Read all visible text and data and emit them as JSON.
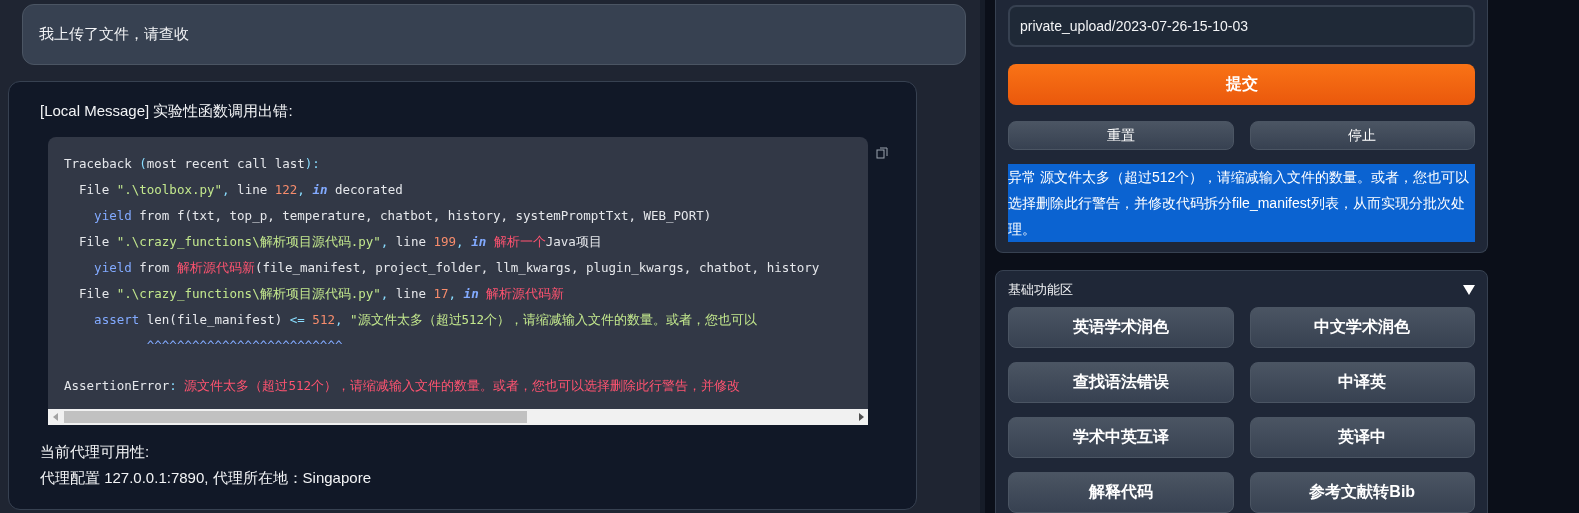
{
  "user_message": {
    "text": "我上传了文件，请查收"
  },
  "bot_message": {
    "title": "[Local Message] 实验性函数调用出错:",
    "code_lines": [
      {
        "kind": "trace",
        "segments": [
          {
            "kind": "plain",
            "text": "Traceback "
          },
          {
            "kind": "punct",
            "text": "("
          },
          {
            "kind": "plain",
            "text": "most recent call last"
          },
          {
            "kind": "punct",
            "text": "):"
          }
        ]
      },
      {
        "kind": "trace",
        "segments": [
          {
            "kind": "plain",
            "text": "  File "
          },
          {
            "kind": "string",
            "text": "\".\\toolbox.py\""
          },
          {
            "kind": "punct",
            "text": ", "
          },
          {
            "kind": "plain",
            "text": "line "
          },
          {
            "kind": "number",
            "text": "122"
          },
          {
            "kind": "punct",
            "text": ", "
          },
          {
            "kind": "keyword",
            "text": "in"
          },
          {
            "kind": "plain",
            "text": " decorated"
          }
        ]
      },
      {
        "kind": "trace",
        "segments": [
          {
            "kind": "builtin",
            "text": "    yield"
          },
          {
            "kind": "plain",
            "text": " from f(txt, top_p, temperature, chatbot, history, systemPromptTxt, WEB_PORT)"
          }
        ]
      },
      {
        "kind": "trace",
        "segments": [
          {
            "kind": "plain",
            "text": "  File "
          },
          {
            "kind": "string",
            "text": "\".\\crazy_functions\\解析项目源代码.py\""
          },
          {
            "kind": "punct",
            "text": ", "
          },
          {
            "kind": "plain",
            "text": "line "
          },
          {
            "kind": "number",
            "text": "199"
          },
          {
            "kind": "punct",
            "text": ", "
          },
          {
            "kind": "keyword",
            "text": "in"
          },
          {
            "kind": "name",
            "text": " 解析一个"
          },
          {
            "kind": "plain",
            "text": "Java项目"
          }
        ]
      },
      {
        "kind": "trace",
        "segments": [
          {
            "kind": "builtin",
            "text": "    yield"
          },
          {
            "kind": "plain",
            "text": " from "
          },
          {
            "kind": "name",
            "text": "解析源代码新"
          },
          {
            "kind": "plain",
            "text": "(file_manifest, project_folder, llm_kwargs, plugin_kwargs, chatbot, history"
          }
        ]
      },
      {
        "kind": "trace",
        "segments": [
          {
            "kind": "plain",
            "text": "  File "
          },
          {
            "kind": "string",
            "text": "\".\\crazy_functions\\解析项目源代码.py\""
          },
          {
            "kind": "punct",
            "text": ", "
          },
          {
            "kind": "plain",
            "text": "line "
          },
          {
            "kind": "number",
            "text": "17"
          },
          {
            "kind": "punct",
            "text": ", "
          },
          {
            "kind": "keyword",
            "text": "in"
          },
          {
            "kind": "name",
            "text": " 解析源代码新"
          }
        ]
      },
      {
        "kind": "trace",
        "segments": [
          {
            "kind": "builtin",
            "text": "    assert"
          },
          {
            "kind": "plain",
            "text": " len(file_manifest) "
          },
          {
            "kind": "punct",
            "text": "<="
          },
          {
            "kind": "number",
            "text": " 512"
          },
          {
            "kind": "punct",
            "text": ", "
          },
          {
            "kind": "string",
            "text": "\"源文件太多（超过512个），请缩减输入文件的数量。或者，您也可以"
          }
        ]
      },
      {
        "kind": "trace",
        "segments": [
          {
            "kind": "builtin",
            "text": "           ^^^^^^^^^^^^^^^^^^^^^^^^^^"
          }
        ]
      },
      {
        "kind": "error",
        "segments": [
          {
            "kind": "plain",
            "text": "AssertionError"
          },
          {
            "kind": "punct",
            "text": ": "
          },
          {
            "kind": "name",
            "text": "源文件太多（超过512个），请缩减输入文件的数量。或者，您也可以选择删除此行警告，并修改"
          }
        ]
      }
    ],
    "proxy_lines": [
      "当前代理可用性:",
      "代理配置 127.0.0.1:7890, 代理所在地：Singapore"
    ]
  },
  "input_panel": {
    "path_field": {
      "value": "private_upload/2023-07-26-15-10-03"
    },
    "submit_button": "提交",
    "buttons": [
      "重置",
      "停止"
    ],
    "status": {
      "text": "异常 源文件太多（超过512个），请缩减输入文件的数量。或者，您也可以选择删除此行警告，并修改代码拆分file_manifest列表，从而实现分批次处理。",
      "selected": true
    }
  },
  "function_area": {
    "title": "基础功能区",
    "expanded": true,
    "buttons": [
      "英语学术润色",
      "中文学术润色",
      "查找语法错误",
      "中译英",
      "学术中英互译",
      "英译中",
      "解释代码",
      "参考文献转Bib"
    ]
  }
}
